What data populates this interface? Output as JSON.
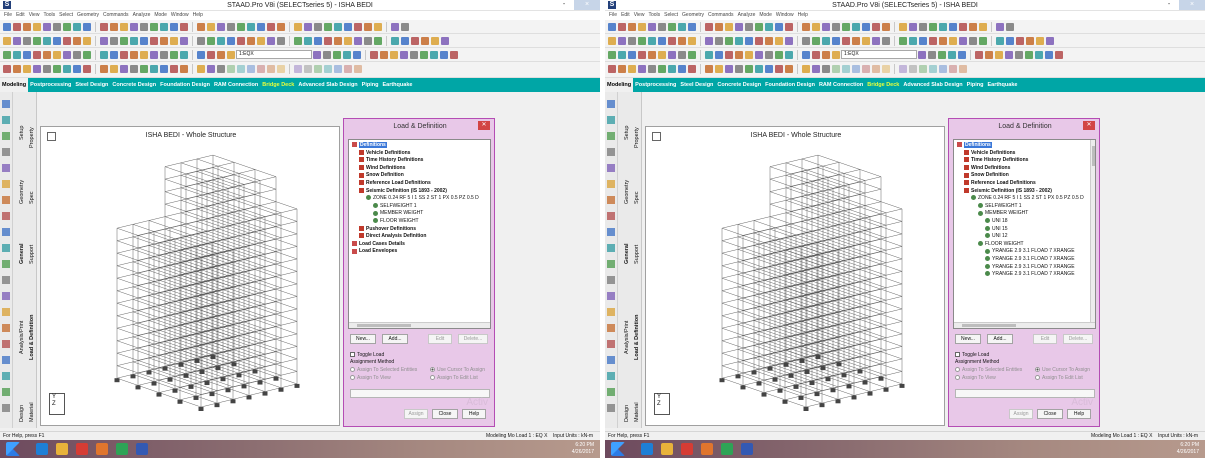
{
  "window": {
    "title": "STAAD.Pro V8i (SELECTseries 5) - ISHA BEDI",
    "minimize_glyph": "-",
    "maximize_glyph": "☐",
    "close_glyph": "×"
  },
  "menu": [
    "File",
    "Edit",
    "View",
    "Tools",
    "Select",
    "Geometry",
    "Commands",
    "Analyze",
    "Mode",
    "Window",
    "Help"
  ],
  "toolbar": {
    "load_combo": "1:EQX"
  },
  "tabs": [
    "Modeling",
    "Postprocessing",
    "Steel Design",
    "Concrete Design",
    "Foundation Design",
    "RAM Connection",
    "Bridge Deck",
    "Advanced Slab Design",
    "Piping",
    "Earthquake"
  ],
  "sidebar": {
    "col1": [
      "Setup",
      "Geometry",
      "General",
      "Analysis/Print",
      "Design"
    ],
    "col2": [
      "Property",
      "Spec",
      "Support",
      "Load & Definition",
      "Material"
    ]
  },
  "viewport": {
    "title": "ISHA BEDI - Whole Structure",
    "axis_y": "Y",
    "axis_z": "Z",
    "axis_x": "X"
  },
  "dialog": {
    "title": "Load & Definition",
    "buttons": {
      "new": "New...",
      "add": "Add...",
      "edit": "Edit",
      "delete": "Delete...",
      "assign": "Assign",
      "close": "Close",
      "help": "Help"
    },
    "toggle_load": "Toggle Load",
    "assignment_method": "Assignment Method",
    "radio": {
      "selected": "Assign To Selected Entities",
      "cursor": "Use Cursor To Assign",
      "view": "Assign To View",
      "edit_list": "Assign To Edit List"
    },
    "watermark": "Activ"
  },
  "trees": [
    [
      {
        "label": "Definitions",
        "indent": 0,
        "glyph": "folder",
        "sel": true,
        "bold": true
      },
      {
        "label": "Vehicle Definitions",
        "indent": 1,
        "glyph": "red",
        "bold": true
      },
      {
        "label": "Time History Definitions",
        "indent": 1,
        "glyph": "red",
        "bold": true
      },
      {
        "label": "Wind Definitions",
        "indent": 1,
        "glyph": "red",
        "bold": true
      },
      {
        "label": "Snow Definition",
        "indent": 1,
        "glyph": "red",
        "bold": true
      },
      {
        "label": "Reference Load Definitions",
        "indent": 1,
        "glyph": "red",
        "bold": true
      },
      {
        "label": "Seismic Definition (IS 1893 - 2002)",
        "indent": 1,
        "glyph": "red",
        "bold": true
      },
      {
        "label": "ZONE 0.24 RF 5 I 1 SS 2 ST 1 PX 0.5 PZ 0.5 D",
        "indent": 2,
        "glyph": "load"
      },
      {
        "label": "SELFWEIGHT 1",
        "indent": 3,
        "glyph": "load"
      },
      {
        "label": "MEMBER WEIGHT",
        "indent": 3,
        "glyph": "load"
      },
      {
        "label": "FLOOR WEIGHT",
        "indent": 3,
        "glyph": "load"
      },
      {
        "label": "Pushover Definitions",
        "indent": 1,
        "glyph": "red",
        "bold": true
      },
      {
        "label": "Direct Analysis Definition",
        "indent": 1,
        "glyph": "red",
        "bold": true
      },
      {
        "label": "Load Cases Details",
        "indent": 0,
        "glyph": "folder",
        "bold": true
      },
      {
        "label": "Load Envelopes",
        "indent": 0,
        "glyph": "folder",
        "bold": true
      }
    ],
    [
      {
        "label": "Definitions",
        "indent": 0,
        "glyph": "folder",
        "sel": true,
        "bold": true
      },
      {
        "label": "Vehicle Definitions",
        "indent": 1,
        "glyph": "red",
        "bold": true
      },
      {
        "label": "Time History Definitions",
        "indent": 1,
        "glyph": "red",
        "bold": true
      },
      {
        "label": "Wind Definitions",
        "indent": 1,
        "glyph": "red",
        "bold": true
      },
      {
        "label": "Snow Definition",
        "indent": 1,
        "glyph": "red",
        "bold": true
      },
      {
        "label": "Reference Load Definitions",
        "indent": 1,
        "glyph": "red",
        "bold": true
      },
      {
        "label": "Seismic Definition (IS 1893 - 2002)",
        "indent": 1,
        "glyph": "red",
        "bold": true
      },
      {
        "label": "ZONE 0.24 RF 5 I 1 SS 2 ST 1 PX 0.5 PZ 0.5 D",
        "indent": 2,
        "glyph": "load"
      },
      {
        "label": "SELFWEIGHT 1",
        "indent": 3,
        "glyph": "load"
      },
      {
        "label": "MEMBER WEIGHT",
        "indent": 3,
        "glyph": "load"
      },
      {
        "label": "UNI 18",
        "indent": 4,
        "glyph": "load"
      },
      {
        "label": "UNI 15",
        "indent": 4,
        "glyph": "load"
      },
      {
        "label": "UNI 12",
        "indent": 4,
        "glyph": "load"
      },
      {
        "label": "FLOOR WEIGHT",
        "indent": 3,
        "glyph": "load"
      },
      {
        "label": "YRANGE 2.9 3.1 FLOAD 7 XRANGE",
        "indent": 4,
        "glyph": "load"
      },
      {
        "label": "YRANGE 2.9 3.1 FLOAD 7 XRANGE",
        "indent": 4,
        "glyph": "load"
      },
      {
        "label": "YRANGE 2.9 3.1 FLOAD 7 XRANGE",
        "indent": 4,
        "glyph": "load"
      },
      {
        "label": "YRANGE 2.9 3.1 FLOAD 7 XRANGE",
        "indent": 4,
        "glyph": "load"
      }
    ]
  ],
  "status": {
    "left": "For Help, press F1",
    "mid": "Modeling Mo Load 1 : EQ X",
    "right": "Input Units : kN-m"
  },
  "taskbar": {
    "time": "6:20 PM",
    "date": "4/26/2017"
  },
  "colors": {
    "tab_bar": "#00a6a6",
    "dialog_bg": "#e8c8e8",
    "dialog_border": "#b44db4",
    "selection": "#3b78d8",
    "structure": "#555555"
  }
}
